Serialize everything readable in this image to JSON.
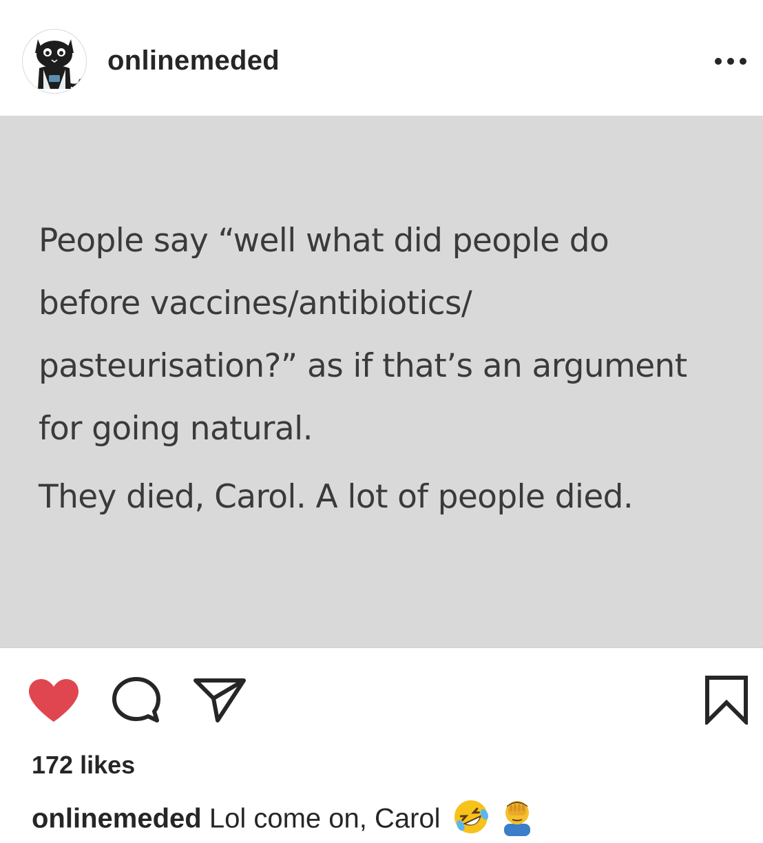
{
  "post": {
    "username": "onlinemeded",
    "image_text": {
      "paragraph1": "People say “well what did people do before vaccines/antibiotics/ pasteurisation?” as if that’s an argument for going natural.",
      "paragraph1_lines": [
        "People say “well what did people do",
        "before vaccines/antibiotics/",
        "pasteurisation?” as if that’s an argument",
        "for going natural."
      ],
      "paragraph2": "They died, Carol. A lot of people died."
    },
    "likes": "172 likes",
    "caption": {
      "username": "onlinemeded",
      "text": "Lol come on, Carol",
      "emojis": [
        "rolling-on-floor-laughing-emoji",
        "man-facepalming-emoji"
      ]
    }
  },
  "icons": {
    "more": "more-options-icon",
    "like": "heart-icon",
    "comment": "comment-icon",
    "share": "paper-plane-icon",
    "save": "bookmark-icon"
  },
  "colors": {
    "heart": "#e0464f",
    "image_background": "#d9d9da",
    "text": "#262626"
  }
}
